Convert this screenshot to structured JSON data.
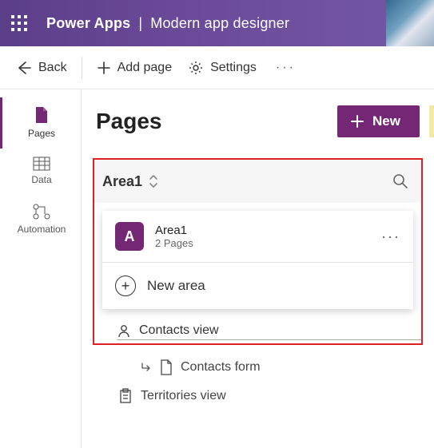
{
  "header": {
    "app": "Power Apps",
    "subtitle": "Modern app designer"
  },
  "toolbar": {
    "back": "Back",
    "add_page": "Add page",
    "settings": "Settings"
  },
  "rail": {
    "pages": "Pages",
    "data": "Data",
    "automation": "Automation"
  },
  "main": {
    "title": "Pages",
    "new_btn": "New"
  },
  "area_selector": {
    "current": "Area1",
    "dropdown": {
      "tile_letter": "A",
      "title": "Area1",
      "subtitle": "2 Pages",
      "new_area": "New area"
    }
  },
  "tree": {
    "contacts_view": "Contacts view",
    "contacts_form": "Contacts form",
    "territories_view": "Territories view"
  }
}
